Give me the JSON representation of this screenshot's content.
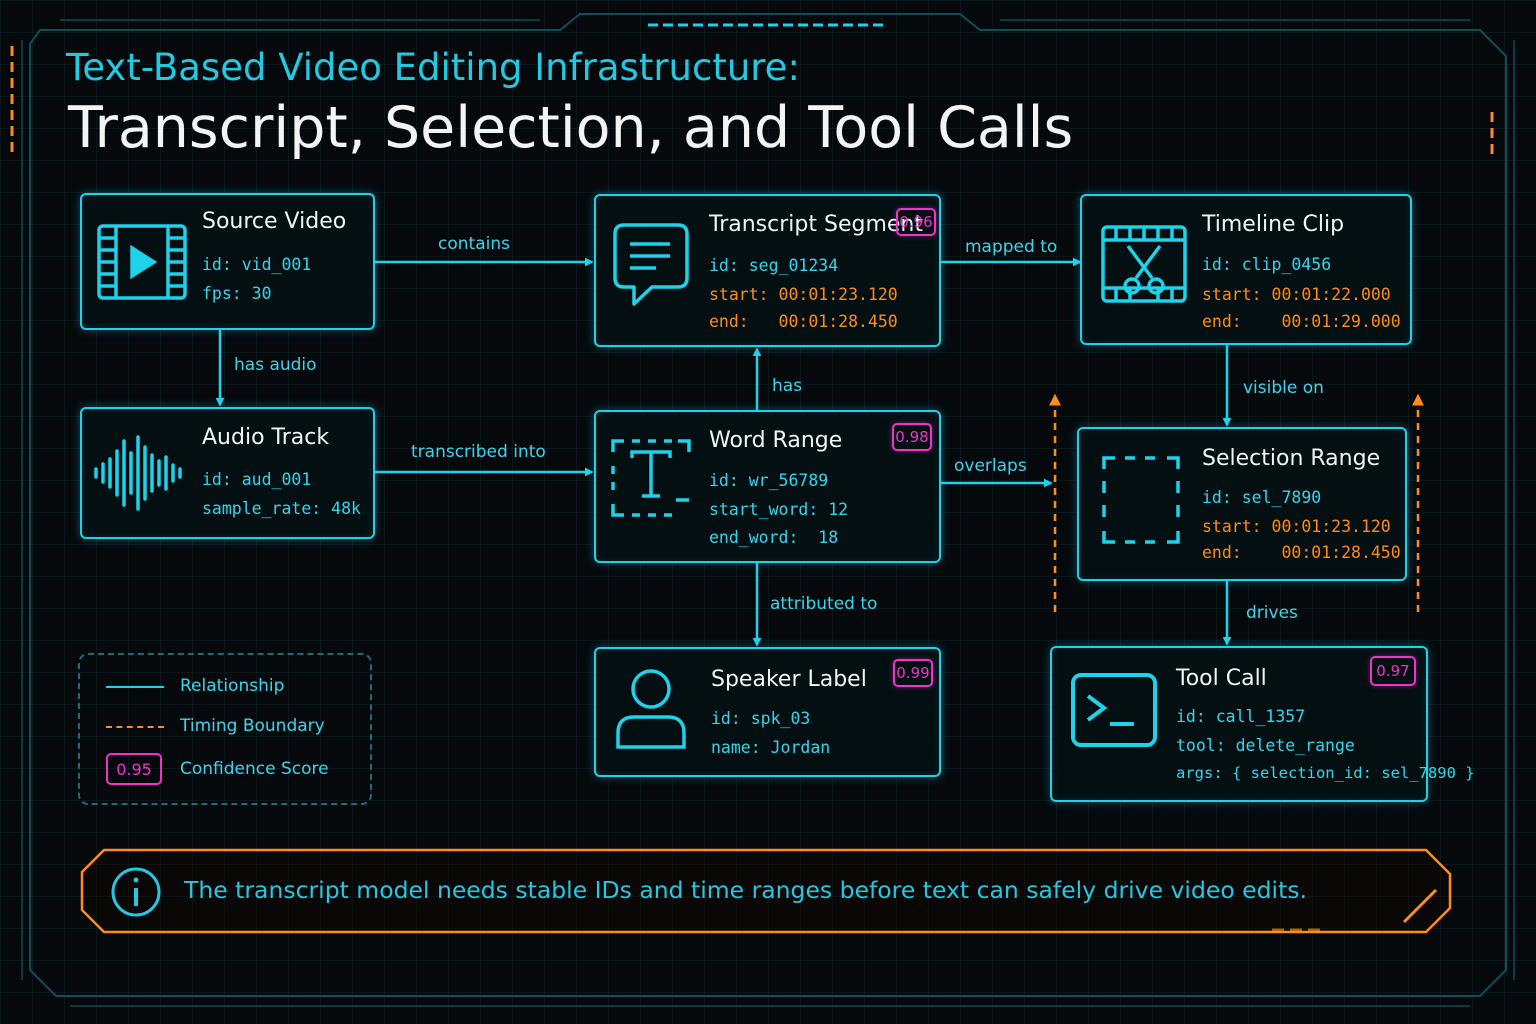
{
  "title": {
    "line1": "Text-Based Video Editing Infrastructure:",
    "line2": "Transcript, Selection, and Tool Calls"
  },
  "nodes": {
    "source_video": {
      "title": "Source Video",
      "icon": "film-play-icon",
      "fields": [
        "id: vid_001",
        "fps: 30"
      ]
    },
    "audio_track": {
      "title": "Audio Track",
      "icon": "waveform-icon",
      "fields": [
        "id: aud_001",
        "sample_rate: 48k"
      ]
    },
    "transcript_segment": {
      "title": "Transcript Segment",
      "icon": "speech-bubble-icon",
      "badge": "0.96",
      "fields": [
        "id: seg_01234",
        "start: 00:01:23.120",
        "end:   00:01:28.450"
      ]
    },
    "word_range": {
      "title": "Word Range",
      "icon": "text-select-icon",
      "badge": "0.98",
      "fields": [
        "id: wr_56789",
        "start_word: 12",
        "end_word:  18"
      ]
    },
    "speaker_label": {
      "title": "Speaker Label",
      "icon": "person-icon",
      "badge": "0.99",
      "fields": [
        "id: spk_03",
        "name: Jordan"
      ]
    },
    "timeline_clip": {
      "title": "Timeline Clip",
      "icon": "film-scissors-icon",
      "fields": [
        "id: clip_0456",
        "start: 00:01:22.000",
        "end:    00:01:29.000"
      ]
    },
    "selection_range": {
      "title": "Selection Range",
      "icon": "dashed-square-icon",
      "fields": [
        "id: sel_7890",
        "start: 00:01:23.120",
        "end:    00:01:28.450"
      ]
    },
    "tool_call": {
      "title": "Tool Call",
      "icon": "terminal-icon",
      "badge": "0.97",
      "fields": [
        "id: call_1357",
        "tool: delete_range",
        "args: { selection_id: sel_7890 }"
      ]
    }
  },
  "edges": {
    "contains": "contains",
    "has_audio": "has audio",
    "transcribed_into": "transcribed into",
    "mapped_to": "mapped to",
    "has": "has",
    "overlaps": "overlaps",
    "attributed_to": "attributed to",
    "visible_on": "visible on",
    "drives": "drives"
  },
  "legend": {
    "relationship": "Relationship",
    "timing_boundary": "Timing Boundary",
    "confidence_badge": "0.95",
    "confidence_score": "Confidence Score"
  },
  "info": {
    "icon": "info-icon",
    "text": "The transcript model needs stable IDs and time ranges before text can safely drive video edits."
  },
  "colors": {
    "cyan": "#1fd2ea",
    "orange": "#ff8c1a",
    "magenta": "#ec36c8",
    "background": "#05090c"
  }
}
